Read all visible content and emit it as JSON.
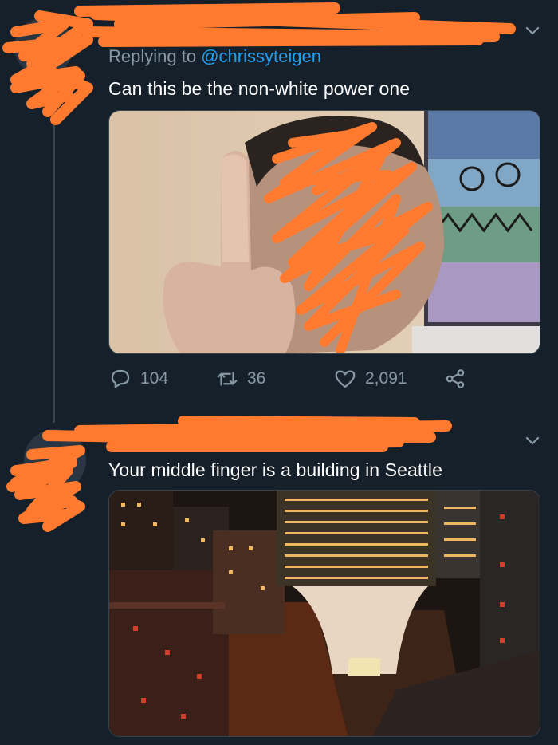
{
  "tweets": [
    {
      "reply_prefix": "Replying to",
      "reply_handle": "@chrissyteigen",
      "text": "Can this be the non-white power one",
      "stats": {
        "replies": "104",
        "retweets": "36",
        "likes": "2,091"
      }
    },
    {
      "text": "Your middle finger is a building in Seattle"
    }
  ],
  "colors": {
    "background": "#15202b",
    "accent": "#1da1f2",
    "secondary_text": "#8899a6",
    "redaction": "#ff7a2e"
  },
  "icons": [
    "chevron-down-icon",
    "reply-icon",
    "retweet-icon",
    "like-icon",
    "share-icon"
  ]
}
